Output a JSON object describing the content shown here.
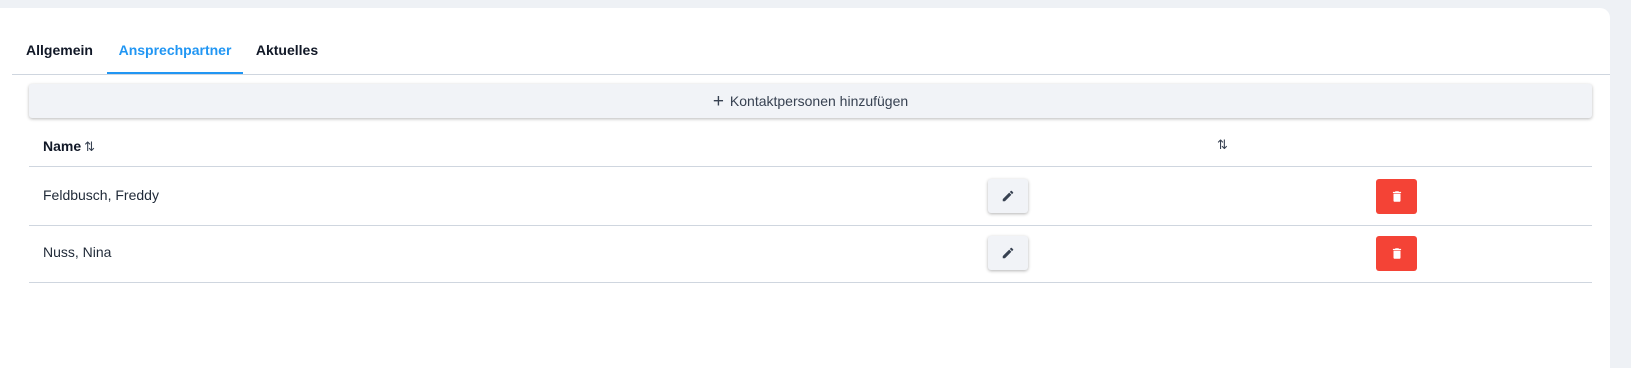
{
  "tabs": [
    {
      "label": "Allgemein",
      "active": false
    },
    {
      "label": "Ansprechpartner",
      "active": true
    },
    {
      "label": "Aktuelles",
      "active": false
    }
  ],
  "add_button": {
    "icon": "plus-icon",
    "label": "Kontaktpersonen hinzufügen"
  },
  "table": {
    "columns": [
      {
        "label": "Name",
        "sort_icon": "⇅"
      },
      {
        "label": "",
        "sort_icon": "⇅"
      }
    ],
    "rows": [
      {
        "name": "Feldbusch, Freddy",
        "edit_icon": "pencil-icon",
        "delete_icon": "trash-icon"
      },
      {
        "name": "Nuss, Nina",
        "edit_icon": "pencil-icon",
        "delete_icon": "trash-icon"
      }
    ]
  },
  "colors": {
    "accent": "#2196f3",
    "danger": "#f44336",
    "button_bg": "#f1f3f7",
    "divider": "#cfd6df"
  }
}
